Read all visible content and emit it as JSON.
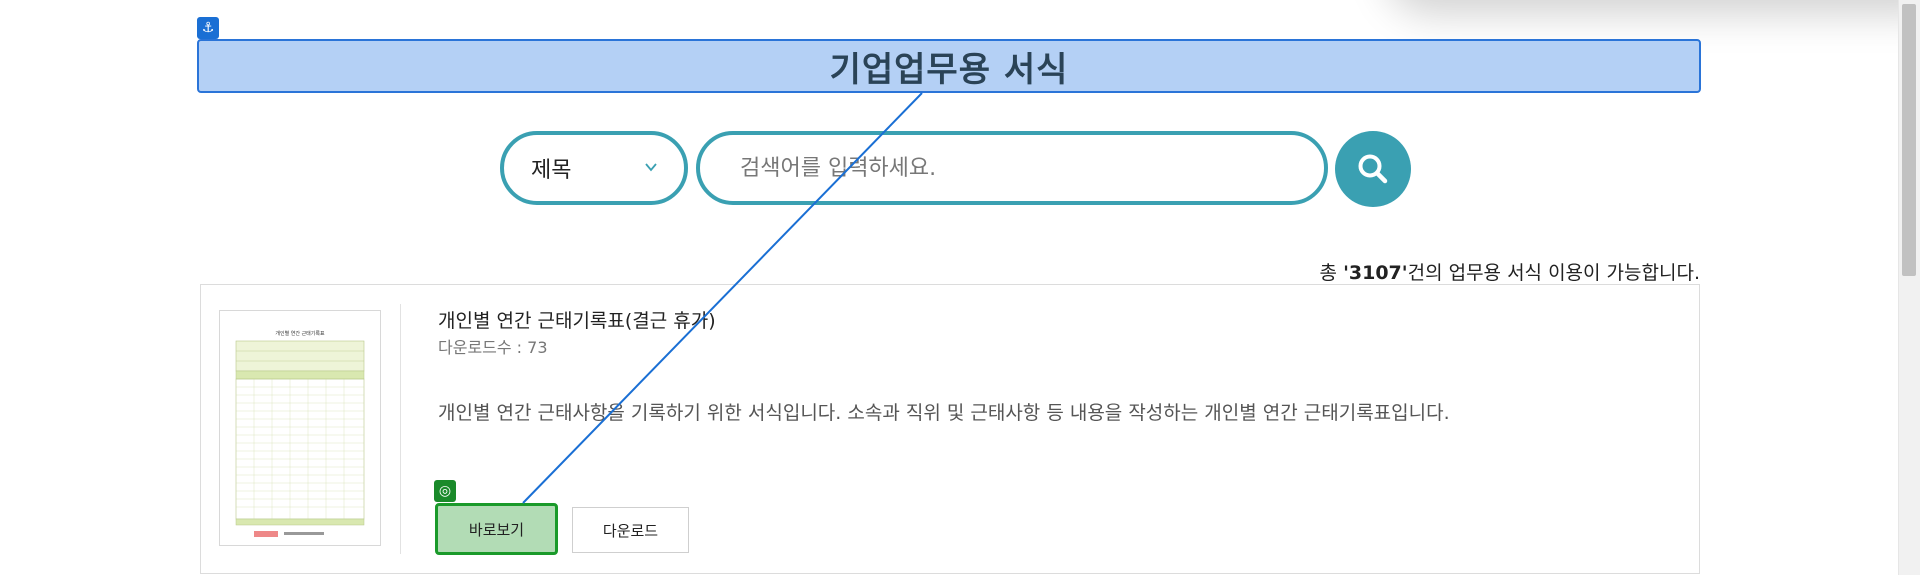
{
  "page": {
    "title": "기업업무용 서식",
    "anchor_icon": "anchor-icon",
    "target_icon": "target-icon"
  },
  "search": {
    "select_value": "제목",
    "placeholder": "검색어를 입력하세요.",
    "button_icon": "search-icon"
  },
  "summary": {
    "prefix": "총 ",
    "count": "'3107'",
    "suffix": "건의 업무용 서식 이용이 가능합니다."
  },
  "result": {
    "title": "개인별 연간 근태기록표(결근 휴가)",
    "downloads": "다운로드수 : 73",
    "description": "개인별 연간 근태사항을 기록하기 위한 서식입니다. 소속과 직위 및 근태사항 등 내용을 작성하는 개인별 연간 근태기록표입니다.",
    "preview_label": "바로보기",
    "download_label": "다운로드",
    "thumbnail_title": "개인별 연간 근태기록표"
  },
  "colors": {
    "accent": "#3aa0b2",
    "banner_fill": "#b4d0f5",
    "banner_border": "#2a74d8",
    "preview_fill": "#b2dcb5",
    "preview_border": "#1a9a2a",
    "connector_line": "#1a6fd4"
  }
}
